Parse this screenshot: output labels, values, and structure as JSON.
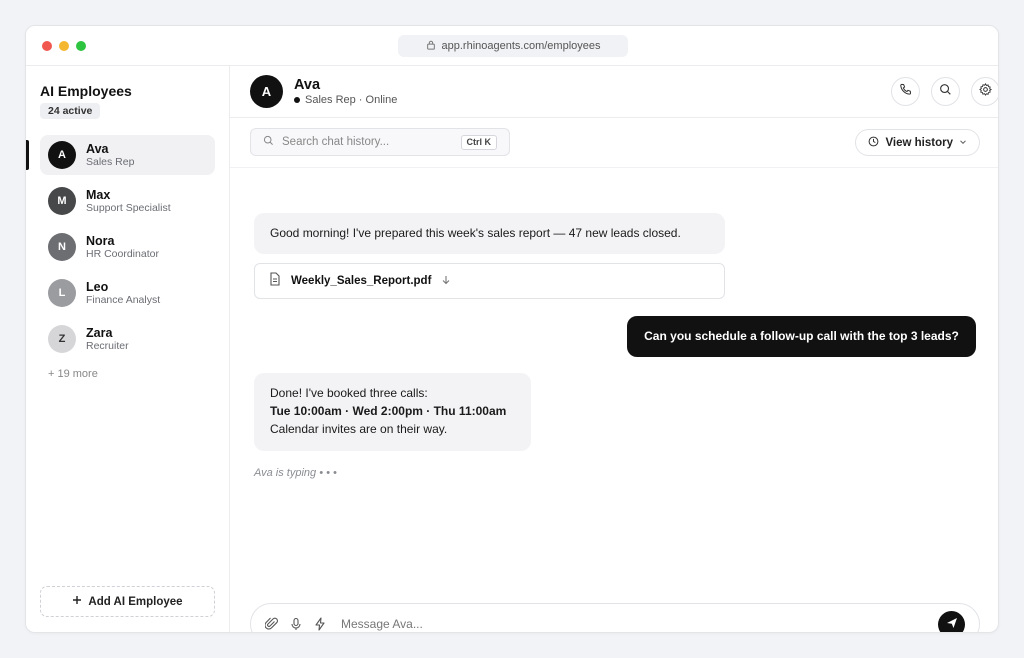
{
  "browser": {
    "url": "app.rhinoagents.com/employees"
  },
  "sidebar": {
    "title": "AI Employees",
    "active_badge": "24 active",
    "employees": [
      {
        "initial": "A",
        "name": "Ava",
        "role": "Sales Rep",
        "color": "#111111"
      },
      {
        "initial": "M",
        "name": "Max",
        "role": "Support Specialist",
        "color": "#474849"
      },
      {
        "initial": "N",
        "name": "Nora",
        "role": "HR Coordinator",
        "color": "#6d6e72"
      },
      {
        "initial": "L",
        "name": "Leo",
        "role": "Finance Analyst",
        "color": "#9b9ca0"
      },
      {
        "initial": "Z",
        "name": "Zara",
        "role": "Recruiter",
        "color": "#d6d6d9"
      }
    ],
    "more": "+ 19 more",
    "add_button": "Add AI Employee"
  },
  "chat_header": {
    "initial": "A",
    "name": "Ava",
    "status": "Sales Rep · Online"
  },
  "toolbar": {
    "search_placeholder": "Search chat history...",
    "shortcut": "Ctrl K",
    "view_history": "View history"
  },
  "messages": {
    "m1": "Good morning! I've prepared this week's sales report — 47 new leads closed.",
    "attachment": "Weekly_Sales_Report.pdf",
    "m2": "Can you schedule a follow-up call with the top 3 leads?",
    "m3_line1": "Done! I've booked three calls:",
    "m3_line2": "Tue 10:00am · Wed 2:00pm · Thu 11:00am",
    "m3_line3": "Calendar invites are on their way."
  },
  "typing": "Ava is typing • • •",
  "composer": {
    "placeholder": "Message Ava..."
  }
}
